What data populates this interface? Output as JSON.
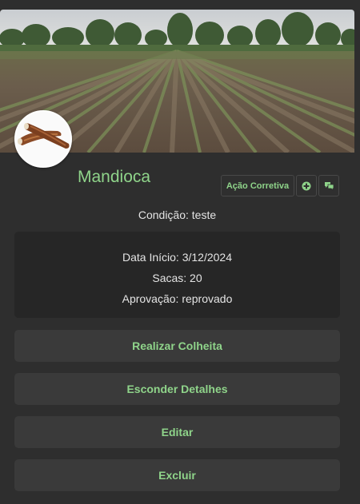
{
  "crop": {
    "name": "Mandioca",
    "condition": "Condição: teste",
    "details": {
      "start_date": "Data Início: 3/12/2024",
      "bags": "Sacas: 20",
      "approval": "Aprovação: reprovado"
    }
  },
  "actions": {
    "corrective_label": "Ação Corretiva",
    "add_icon": "plus-circle-icon",
    "chat_icon": "chat-icon"
  },
  "buttons": {
    "harvest": "Realizar Colheita",
    "hide_details": "Esconder Detalhes",
    "edit": "Editar",
    "delete": "Excluir"
  },
  "colors": {
    "accent": "#8fd48a",
    "background": "#2e2e2e",
    "button_bg": "#3a3a3a",
    "panel_bg": "#262626"
  }
}
